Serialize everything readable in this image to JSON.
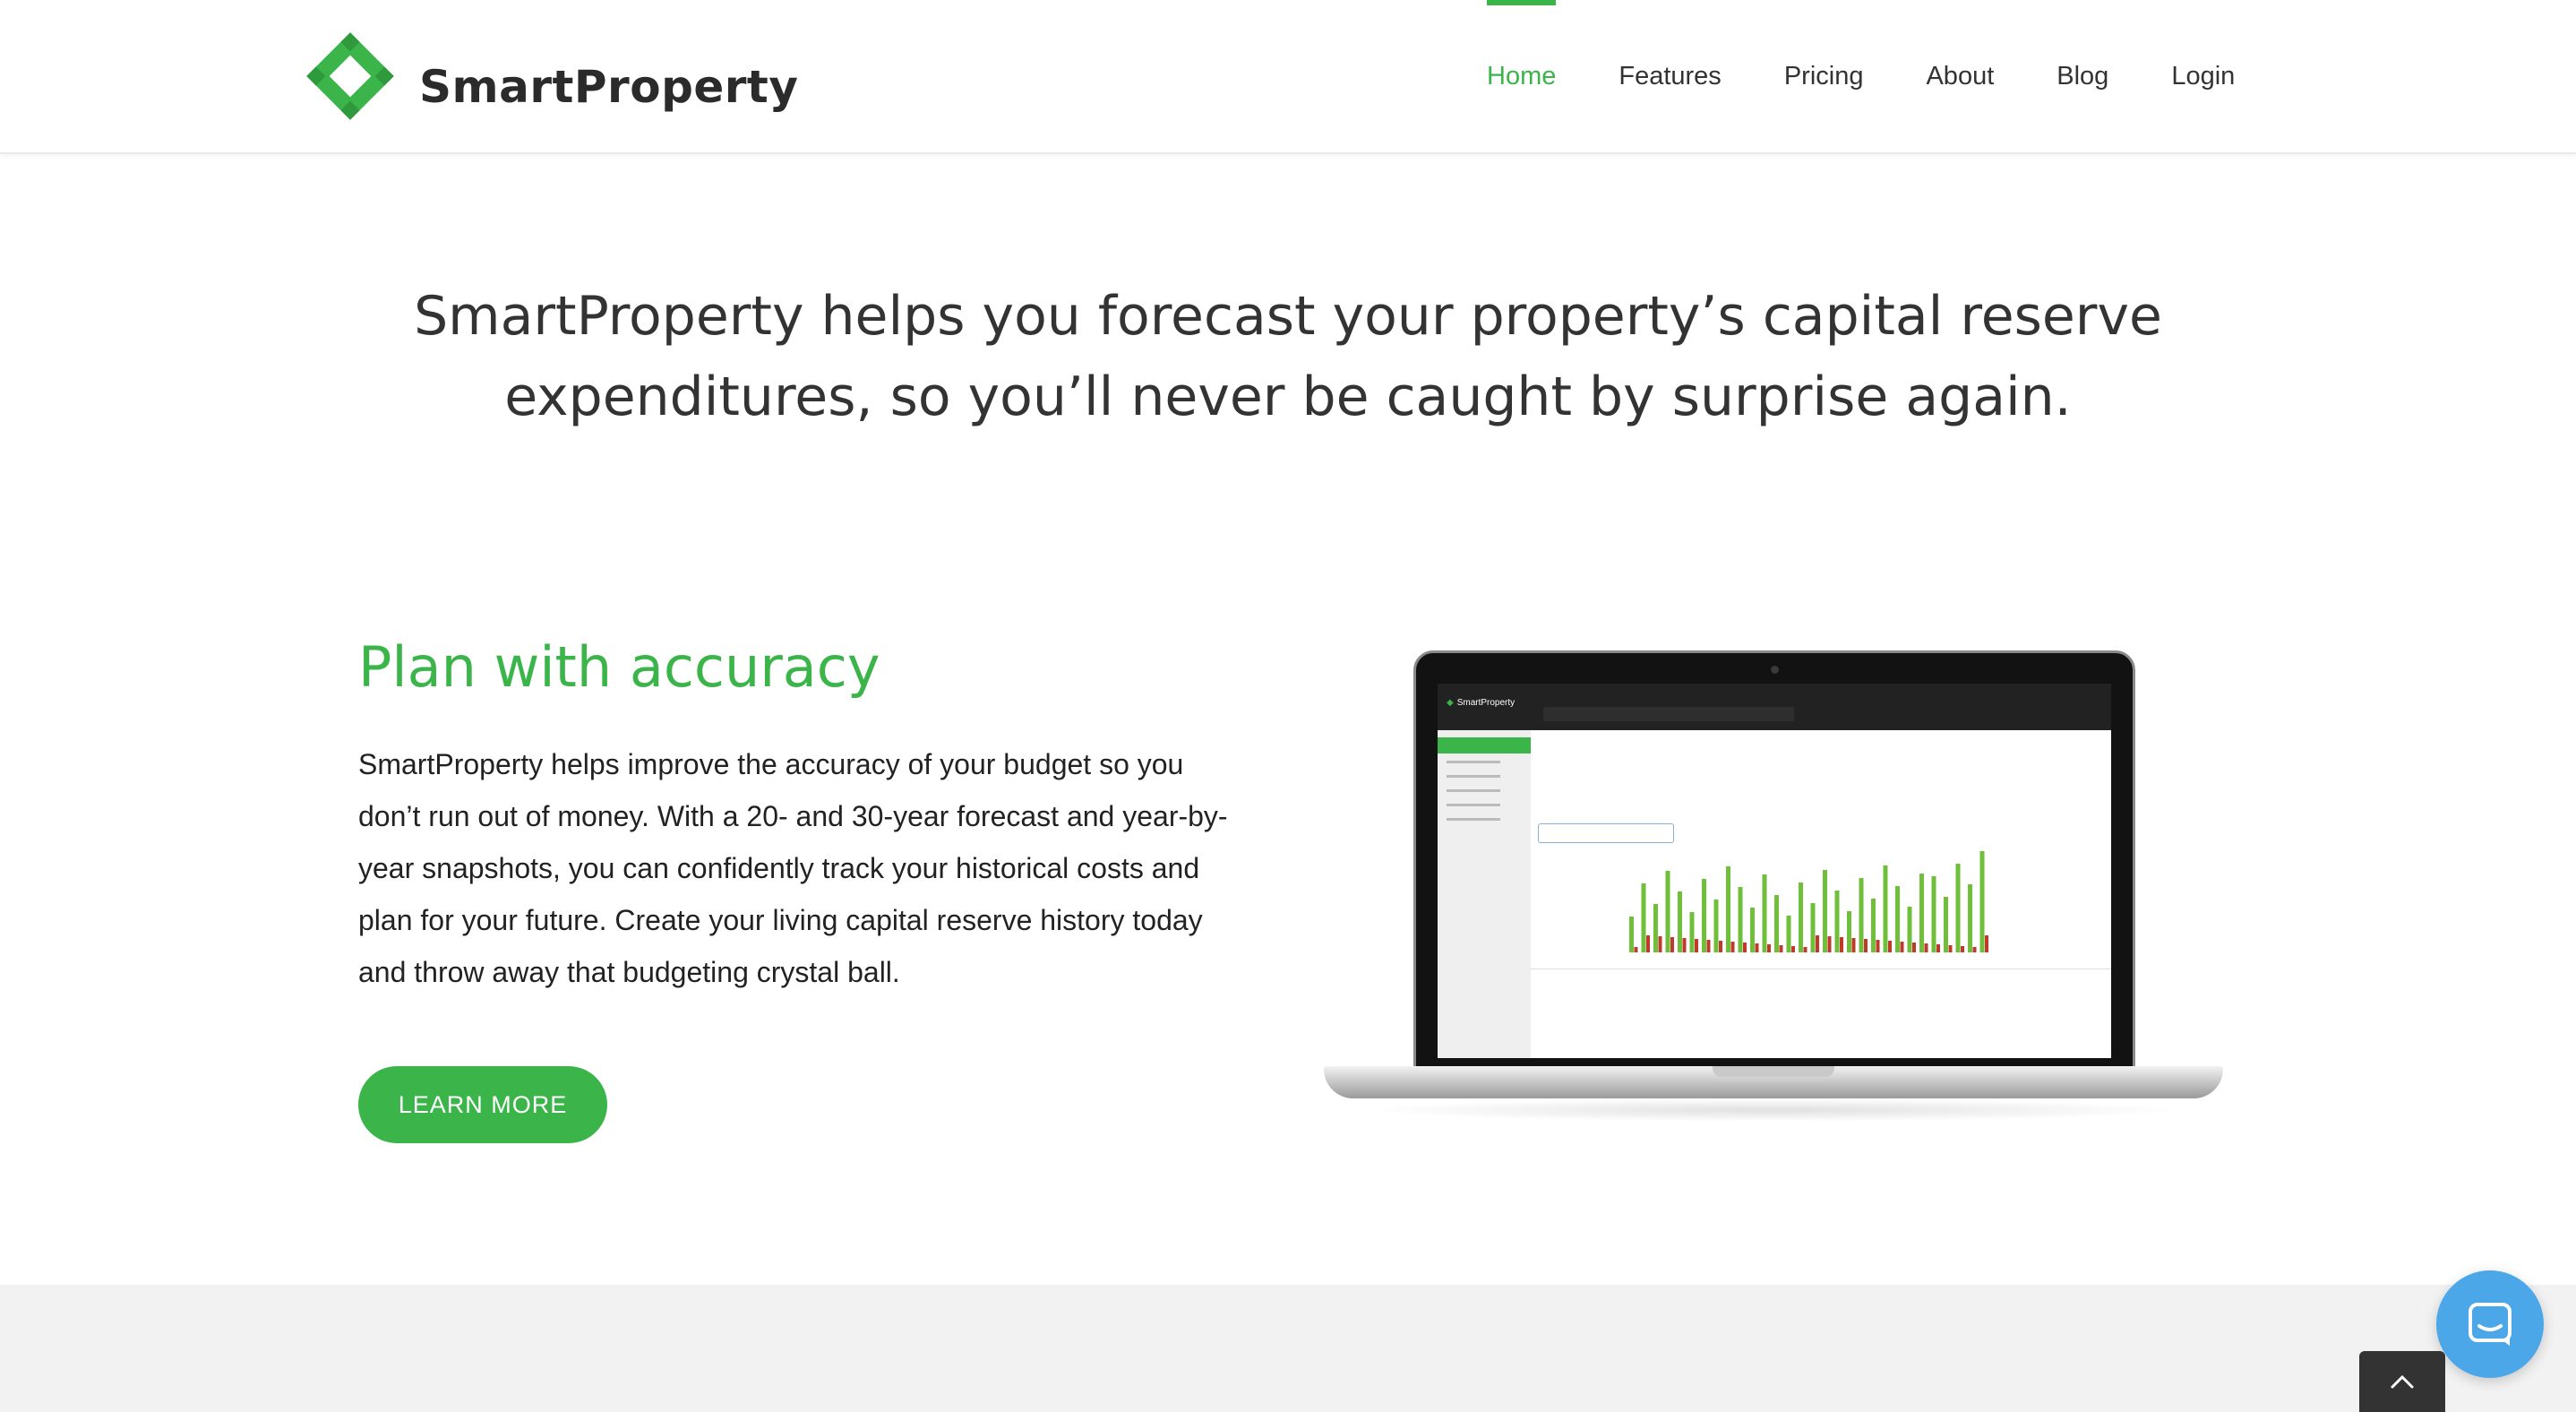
{
  "brand": {
    "name": "SmartProperty",
    "green": "#3bb54a"
  },
  "nav": {
    "items": [
      {
        "label": "Home",
        "active": true
      },
      {
        "label": "Features",
        "active": false
      },
      {
        "label": "Pricing",
        "active": false
      },
      {
        "label": "About",
        "active": false
      },
      {
        "label": "Blog",
        "active": false
      },
      {
        "label": "Login",
        "active": false
      }
    ]
  },
  "hero": {
    "line1": "SmartProperty helps you forecast your property’s capital reserve",
    "line2": "expenditures, so you’ll never be caught by surprise again."
  },
  "feature": {
    "title": "Plan with accuracy",
    "body_lines": [
      "SmartProperty helps improve the accuracy of your budget so you",
      "don’t run out of money. With a 20- and 30-year forecast and year-by-",
      "year snapshots, you can confidently track your historical costs and",
      "plan for your future. Create your living capital reserve history today",
      "and throw away that budgeting crystal ball."
    ],
    "button_label": "LEARN MORE"
  },
  "laptop_mockup": {
    "app_logo": "SmartProperty"
  },
  "widgets": {
    "chat_icon": "chat-bubble-icon",
    "scroll_top_icon": "chevron-up-icon",
    "chat_color": "#4ba7e8"
  }
}
